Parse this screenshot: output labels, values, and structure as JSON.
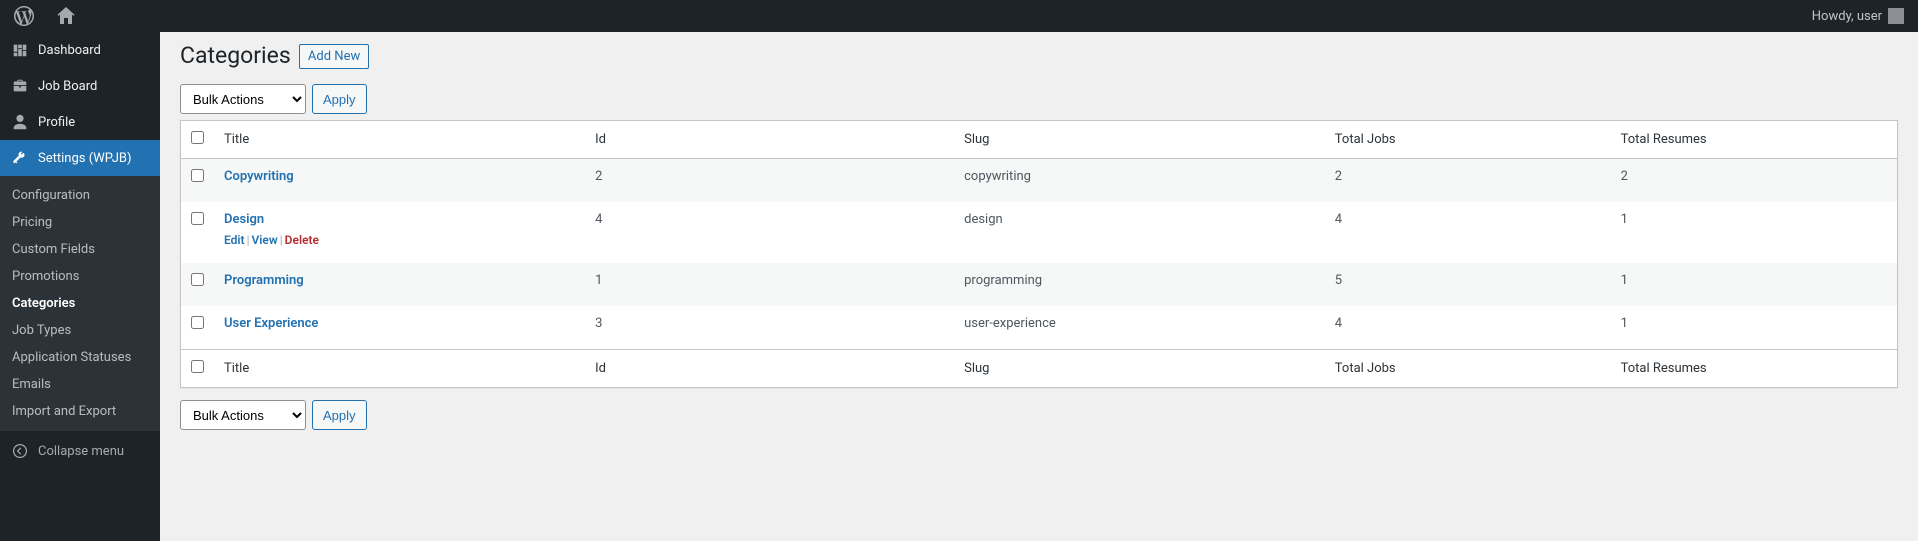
{
  "adminbar": {
    "howdy": "Howdy, user"
  },
  "sidebar": {
    "items": [
      {
        "label": "Dashboard"
      },
      {
        "label": "Job Board"
      },
      {
        "label": "Profile"
      },
      {
        "label": "Settings (WPJB)"
      }
    ],
    "submenu": [
      {
        "label": "Configuration"
      },
      {
        "label": "Pricing"
      },
      {
        "label": "Custom Fields"
      },
      {
        "label": "Promotions"
      },
      {
        "label": "Categories"
      },
      {
        "label": "Job Types"
      },
      {
        "label": "Application Statuses"
      },
      {
        "label": "Emails"
      },
      {
        "label": "Import and Export"
      }
    ],
    "collapse": "Collapse menu"
  },
  "page": {
    "heading": "Categories",
    "add_new": "Add New"
  },
  "tablenav": {
    "bulk_actions": "Bulk Actions",
    "apply": "Apply"
  },
  "columns": {
    "title": "Title",
    "id": "Id",
    "slug": "Slug",
    "total_jobs": "Total Jobs",
    "total_resumes": "Total Resumes"
  },
  "row_actions": {
    "edit": "Edit",
    "view": "View",
    "delete": "Delete"
  },
  "rows": [
    {
      "title": "Copywriting",
      "id": "2",
      "slug": "copywriting",
      "jobs": "2",
      "resumes": "2",
      "show_actions": false
    },
    {
      "title": "Design",
      "id": "4",
      "slug": "design",
      "jobs": "4",
      "resumes": "1",
      "show_actions": true
    },
    {
      "title": "Programming",
      "id": "1",
      "slug": "programming",
      "jobs": "5",
      "resumes": "1",
      "show_actions": false
    },
    {
      "title": "User Experience",
      "id": "3",
      "slug": "user-experience",
      "jobs": "4",
      "resumes": "1",
      "show_actions": false
    }
  ]
}
